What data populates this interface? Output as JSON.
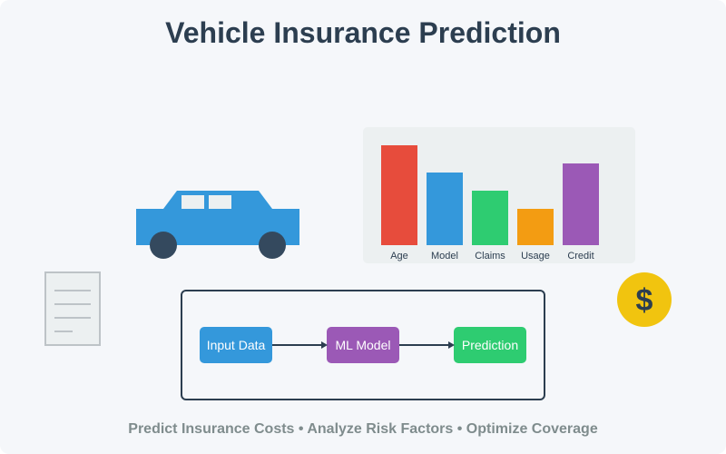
{
  "title": "Vehicle Insurance Prediction",
  "tagline": "Predict Insurance Costs • Analyze Risk Factors • Optimize Coverage",
  "chart_data": {
    "type": "bar",
    "categories": [
      "Age",
      "Model",
      "Claims",
      "Usage",
      "Credit"
    ],
    "values": [
      110,
      80,
      60,
      40,
      90
    ],
    "colors": [
      "#e74c3c",
      "#3498db",
      "#2ecc71",
      "#f39c12",
      "#9b59b6"
    ],
    "ylim": [
      0,
      110
    ],
    "grid": false
  },
  "pipeline": {
    "steps": [
      {
        "label": "Input Data",
        "color": "#3498db"
      },
      {
        "label": "ML Model",
        "color": "#9b59b6"
      },
      {
        "label": "Prediction",
        "color": "#2ecc71"
      }
    ]
  },
  "coin": {
    "symbol": "$",
    "color": "#f1c40f"
  },
  "icons": {
    "car": "car-icon",
    "document": "document-icon",
    "coin": "dollar-coin-icon"
  },
  "colors": {
    "background": "#f5f7fa",
    "title": "#2c3e50",
    "car_body": "#3498db",
    "wheel": "#34495e",
    "window": "#ecf0f1",
    "chart_panel": "#ecf0f1",
    "frame": "#2c3e50",
    "footer": "#7f8c8d"
  }
}
